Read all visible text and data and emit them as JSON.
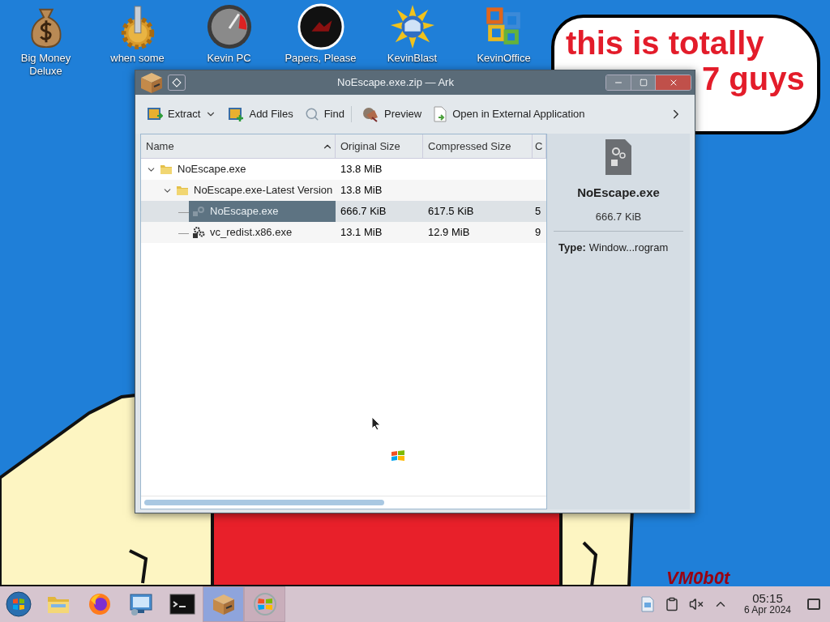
{
  "desktop": {
    "icons": [
      {
        "kind": "money",
        "label": "Big Money Deluxe"
      },
      {
        "kind": "gear",
        "label": "when some"
      },
      {
        "kind": "gauge",
        "label": "Kevin PC"
      },
      {
        "kind": "dark",
        "label": "Papers, Please"
      },
      {
        "kind": "sun",
        "label": "KevinBlast"
      },
      {
        "kind": "office",
        "label": "KevinOffice"
      }
    ],
    "speech_bubble": {
      "lines": [
        "this is totally",
        "7 guys"
      ]
    },
    "signature": "VM0b0t"
  },
  "window": {
    "title": "NoEscape.exe.zip — Ark",
    "toolbar": {
      "groups": [
        [
          {
            "kind": "extract",
            "label": "Extract",
            "menu": true
          },
          {
            "kind": "add",
            "label": "Add Files",
            "menu": false
          },
          {
            "kind": "find",
            "label": "Find",
            "menu": false
          }
        ],
        [
          {
            "kind": "preview",
            "label": "Preview",
            "menu": false
          },
          {
            "kind": "open",
            "label": "Open in External Application",
            "menu": false
          }
        ]
      ]
    },
    "table": {
      "columns": [
        {
          "label": "Name",
          "sorted": true
        },
        {
          "label": "Original Size",
          "sorted": false
        },
        {
          "label": "Compressed Size",
          "sorted": false
        },
        {
          "label": "C",
          "sorted": false
        }
      ],
      "rows": [
        {
          "kind": "folder",
          "name": "NoEscape.exe",
          "original_size": "13.8 MiB",
          "expanded": true,
          "selected": false,
          "children": [
            {
              "kind": "folder",
              "name": "NoEscape.exe-Latest Version",
              "original_size": "13.8 MiB",
              "expanded": true,
              "selected": false,
              "children": [
                {
                  "kind": "exe",
                  "name": "NoEscape.exe",
                  "original_size": "666.7 KiB",
                  "compressed_size": "617.5 KiB",
                  "column_4": "5",
                  "selected": true
                },
                {
                  "kind": "setup",
                  "name": "vc_redist.x86.exe",
                  "original_size": "13.1 MiB",
                  "compressed_size": "12.9 MiB",
                  "column_4": "9",
                  "selected": false
                }
              ]
            }
          ]
        }
      ]
    },
    "details": {
      "name": "NoEscape.exe",
      "size": "666.7 KiB",
      "type_label": "Type:",
      "type_value": "Window...rogram"
    }
  },
  "taskbar": {
    "apps": [
      {
        "kind": "files",
        "selected": false,
        "running": false
      },
      {
        "kind": "firefox",
        "selected": false,
        "running": false
      },
      {
        "kind": "remote",
        "selected": false,
        "running": false
      },
      {
        "kind": "terminal",
        "selected": false,
        "running": false
      },
      {
        "kind": "ark",
        "selected": true,
        "running": true
      },
      {
        "kind": "windows",
        "selected": false,
        "running": true
      }
    ],
    "muted": true,
    "time": "05:15",
    "date": "6 Apr 2024"
  }
}
